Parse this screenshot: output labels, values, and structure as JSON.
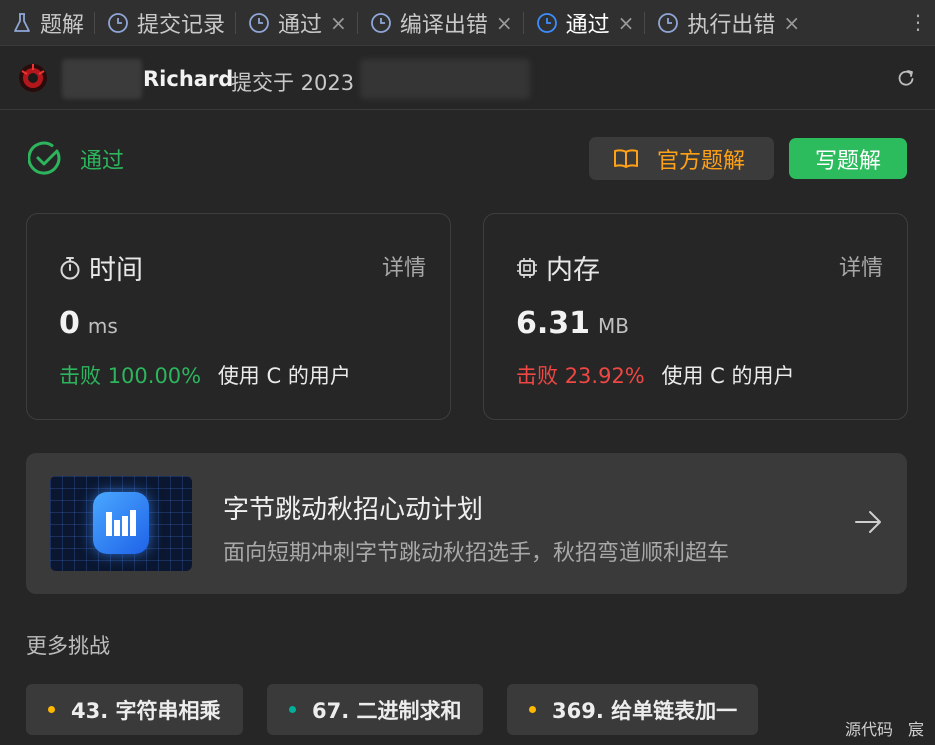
{
  "tabs": [
    {
      "label": "题解",
      "icon": "flask-icon",
      "active": false,
      "closable": false
    },
    {
      "label": "提交记录",
      "icon": "clock-icon",
      "active": false,
      "closable": false
    },
    {
      "label": "通过",
      "icon": "clock-icon",
      "active": false,
      "closable": true
    },
    {
      "label": "编译出错",
      "icon": "clock-icon",
      "active": false,
      "closable": true
    },
    {
      "label": "通过",
      "icon": "clock-icon",
      "active": true,
      "closable": true
    },
    {
      "label": "执行出错",
      "icon": "clock-icon",
      "active": false,
      "closable": true
    }
  ],
  "tab_close_glyph": "×",
  "tab_more_glyph": "⋮",
  "submission": {
    "user": "Richard",
    "meta": "提交于 2023"
  },
  "status": {
    "text": "通过",
    "color": "#2db55d"
  },
  "buttons": {
    "official_solution": "官方题解",
    "write_solution": "写题解"
  },
  "stats": {
    "time": {
      "title": "时间",
      "detail": "详情",
      "value": "0",
      "unit": "ms",
      "beat_label": "击败",
      "beat_percent": "100.00%",
      "beat_suffix": "使用 C 的用户"
    },
    "memory": {
      "title": "内存",
      "detail": "详情",
      "value": "6.31",
      "unit": "MB",
      "beat_label": "击败",
      "beat_percent": "23.92%",
      "beat_suffix": "使用 C 的用户"
    }
  },
  "promo": {
    "title": "字节跳动秋招心动计划",
    "subtitle": "面向短期冲刺字节跳动秋招选手，秋招弯道顺利超车"
  },
  "more": {
    "title": "更多挑战",
    "items": [
      {
        "label": "43. 字符串相乘",
        "dot_color": "#ffb800"
      },
      {
        "label": "67. 二进制求和",
        "dot_color": "#00af9b"
      },
      {
        "label": "369. 给单链表加一",
        "dot_color": "#ffb800"
      }
    ]
  },
  "footer": {
    "source_code": "源代码",
    "extra": "宸"
  },
  "colors": {
    "accent_green": "#2cbb5d",
    "accent_orange": "#ffa116",
    "danger_red": "#ef4743",
    "active_tab_icon": "#3d8dff"
  }
}
